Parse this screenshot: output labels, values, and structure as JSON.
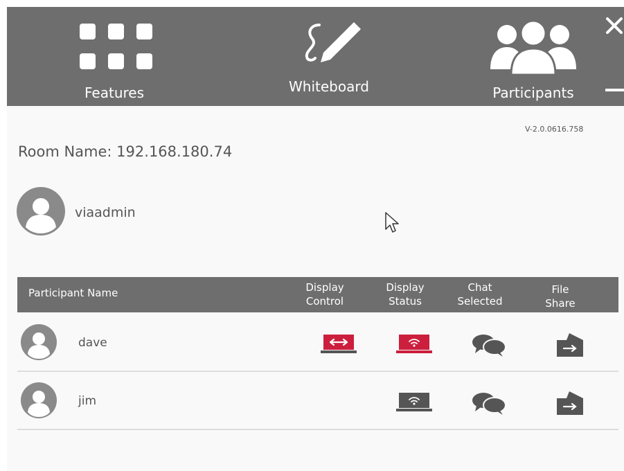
{
  "topbar": {
    "features_label": "Features",
    "whiteboard_label": "Whiteboard",
    "participants_label": "Participants"
  },
  "version": "V-2.0.0616.758",
  "room": {
    "label": "Room Name: 192.168.180.74"
  },
  "current_user": {
    "name": "viaadmin"
  },
  "table": {
    "headers": {
      "name": "Participant Name",
      "display_control_1": "Display",
      "display_control_2": "Control",
      "display_status_1": "Display",
      "display_status_2": "Status",
      "chat_1": "Chat",
      "chat_2": "Selected",
      "file_1": "File",
      "file_2": "Share"
    },
    "rows": [
      {
        "name": "dave",
        "display_control": "active",
        "display_status": "active"
      },
      {
        "name": "jim",
        "display_control": "none",
        "display_status": "inactive"
      }
    ]
  },
  "colors": {
    "header_bg": "#6e6e6e",
    "accent_red": "#cc1f3d",
    "icon_gray": "#555555",
    "avatar_gray": "#8a8a8a"
  }
}
